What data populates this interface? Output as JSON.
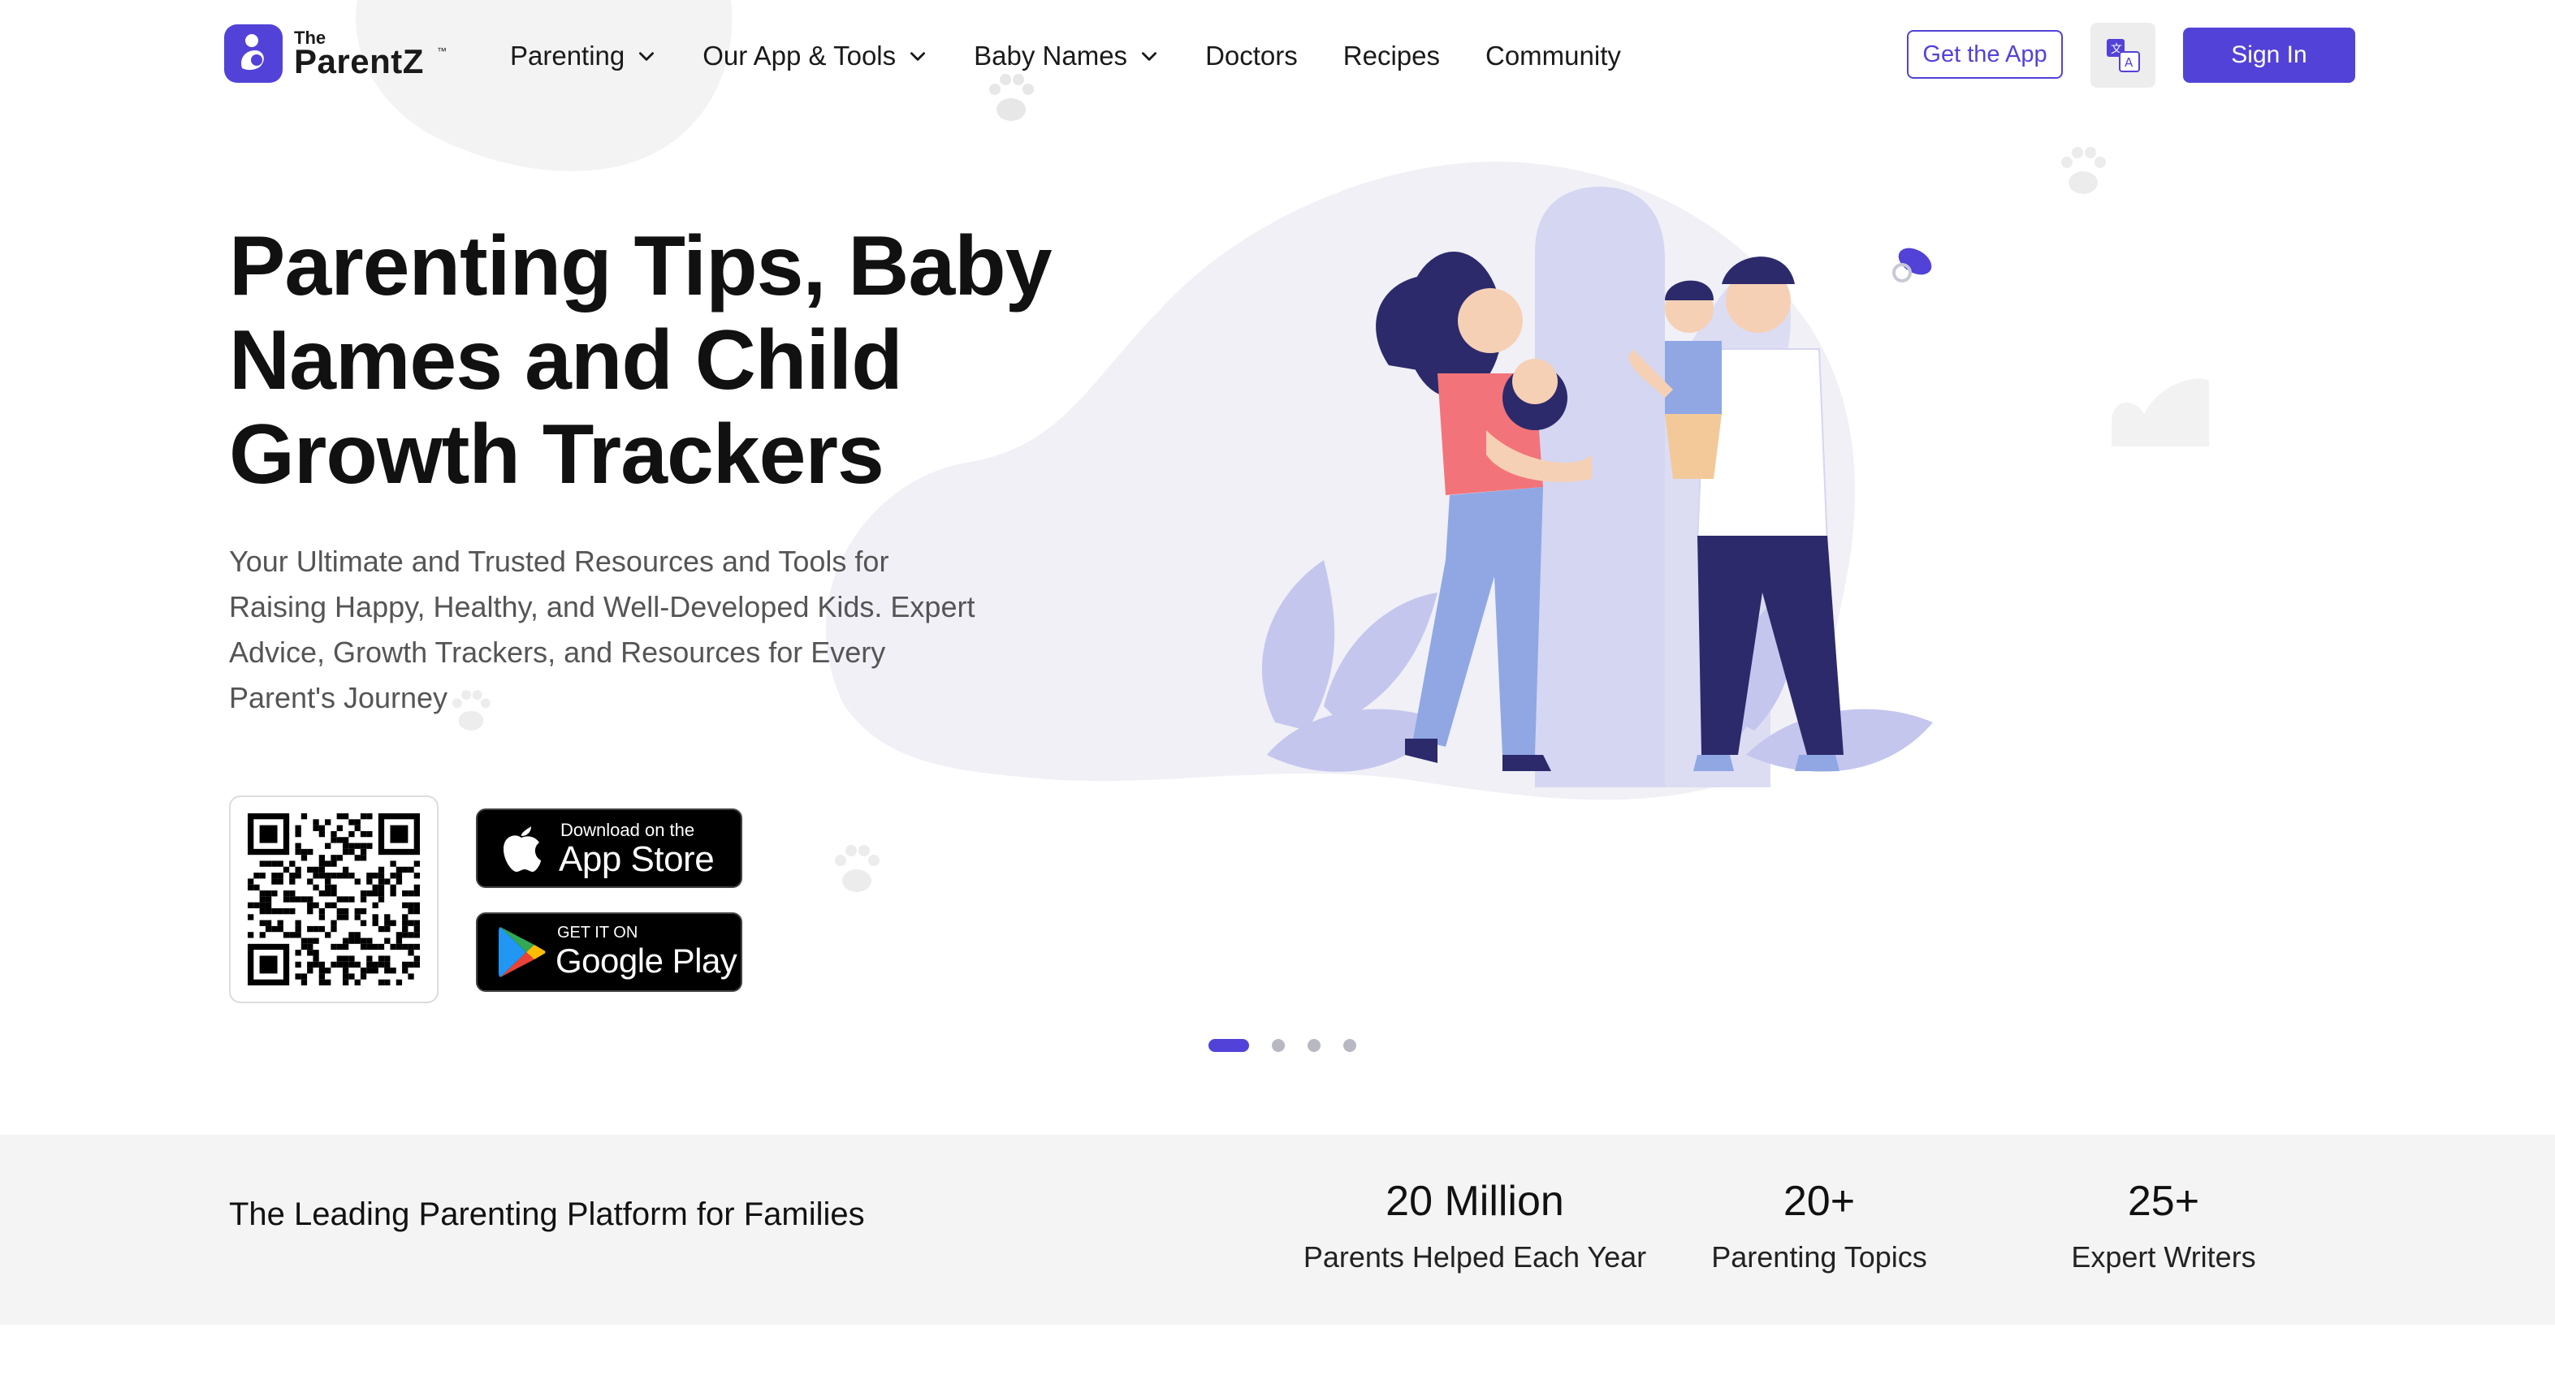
{
  "brand": {
    "logo_the": "The",
    "logo_name": "ParentZ",
    "logo_tm": "™",
    "accent": "#5242d8"
  },
  "nav": {
    "items": [
      {
        "label": "Parenting",
        "dropdown": true
      },
      {
        "label": "Our App & Tools",
        "dropdown": true
      },
      {
        "label": "Baby Names",
        "dropdown": true
      },
      {
        "label": "Doctors",
        "dropdown": false
      },
      {
        "label": "Recipes",
        "dropdown": false
      },
      {
        "label": "Community",
        "dropdown": false
      }
    ],
    "get_app_label": "Get the App",
    "language_icon": "translate-icon",
    "sign_in_label": "Sign In"
  },
  "hero": {
    "title_line1": "Parenting Tips, Baby",
    "title_line2": "Names and Child",
    "title_line3": "Growth Trackers",
    "subtitle_line1": "Your Ultimate and Trusted Resources and Tools for",
    "subtitle_line2": "Raising Happy, Healthy, and Well-Developed Kids. Expert",
    "subtitle_line3": "Advice, Growth Trackers, and Resources for Every",
    "subtitle_line4": "Parent's Journey",
    "app_store": {
      "small": "Download on the",
      "big": "App Store"
    },
    "google_play": {
      "small": "GET IT ON",
      "big": "Google Play"
    },
    "carousel": {
      "total": 4,
      "active": 1
    }
  },
  "stats": {
    "tagline": "The Leading Parenting Platform for Families",
    "items": [
      {
        "value": "20 Million",
        "label": "Parents Helped Each Year"
      },
      {
        "value": "20+",
        "label": "Parenting Topics"
      },
      {
        "value": "25+",
        "label": "Expert Writers"
      }
    ]
  }
}
